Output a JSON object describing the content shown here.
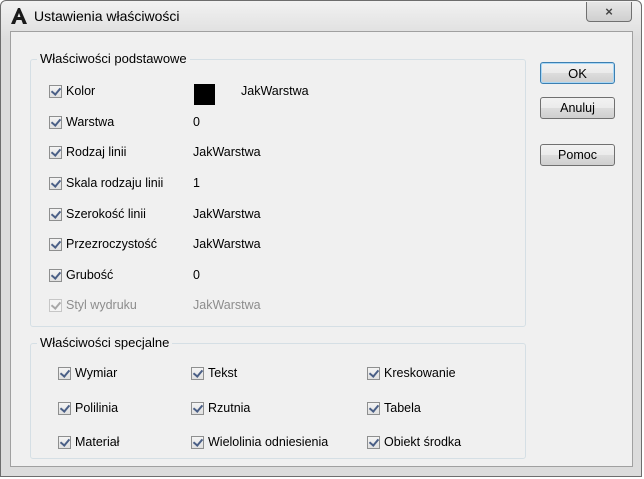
{
  "window": {
    "title": "Ustawienia właściwości",
    "close_glyph": "×"
  },
  "basic": {
    "title": "Właściwości podstawowe",
    "items": [
      {
        "label": "Kolor",
        "value": "JakWarstwa"
      },
      {
        "label": "Warstwa",
        "value": "0"
      },
      {
        "label": "Rodzaj linii",
        "value": "JakWarstwa"
      },
      {
        "label": "Skala rodzaju linii",
        "value": "1"
      },
      {
        "label": "Szerokość linii",
        "value": "JakWarstwa"
      },
      {
        "label": "Przezroczystość",
        "value": "JakWarstwa"
      },
      {
        "label": "Grubość",
        "value": "0"
      },
      {
        "label": "Styl wydruku",
        "value": "JakWarstwa"
      }
    ],
    "color_swatch": "#000000"
  },
  "special": {
    "title": "Właściwości specjalne",
    "items": [
      {
        "label": "Wymiar"
      },
      {
        "label": "Tekst"
      },
      {
        "label": "Kreskowanie"
      },
      {
        "label": "Polilinia"
      },
      {
        "label": "Rzutnia"
      },
      {
        "label": "Tabela"
      },
      {
        "label": "Materiał"
      },
      {
        "label": "Wielolinia odniesienia"
      },
      {
        "label": "Obiekt środka"
      }
    ]
  },
  "buttons": {
    "ok": "OK",
    "cancel": "Anuluj",
    "help": "Pomoc"
  }
}
